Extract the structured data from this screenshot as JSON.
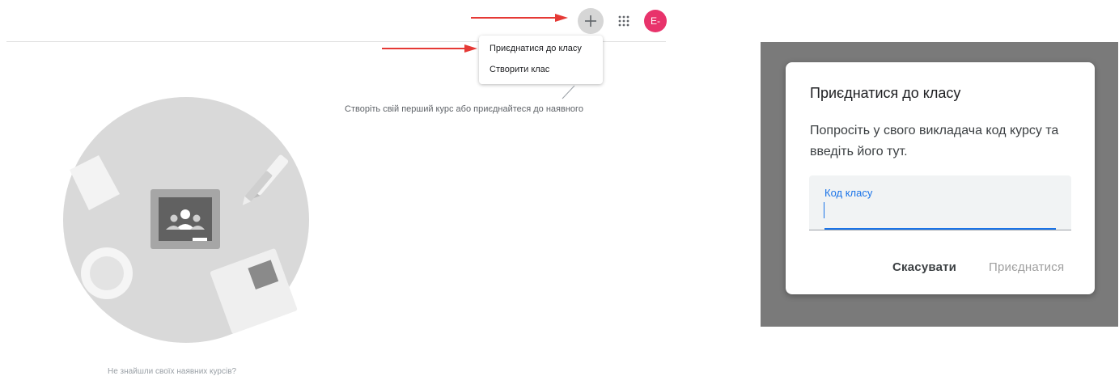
{
  "header": {
    "plus_symbol": "+",
    "apps_icon": "apps-grid-icon",
    "avatar_letter": "E-",
    "avatar_color": "#e8336b"
  },
  "menu": {
    "items": [
      {
        "label": "Приєднатися до класу"
      },
      {
        "label": "Створити клас"
      }
    ]
  },
  "hint": "Створіть свій перший курс або приєднайтеся до наявного",
  "bottom_hint": "Не знайшли своїх наявних курсів?",
  "dialog": {
    "title": "Приєднатися до класу",
    "body": "Попросіть у свого викладача код курсу та введіть його тут.",
    "field_label": "Код класу",
    "field_value": "",
    "cancel_label": "Скасувати",
    "join_label": "Приєднатися",
    "accent": "#1a73e8"
  },
  "annotations": {
    "arrow_color": "#e53935"
  }
}
